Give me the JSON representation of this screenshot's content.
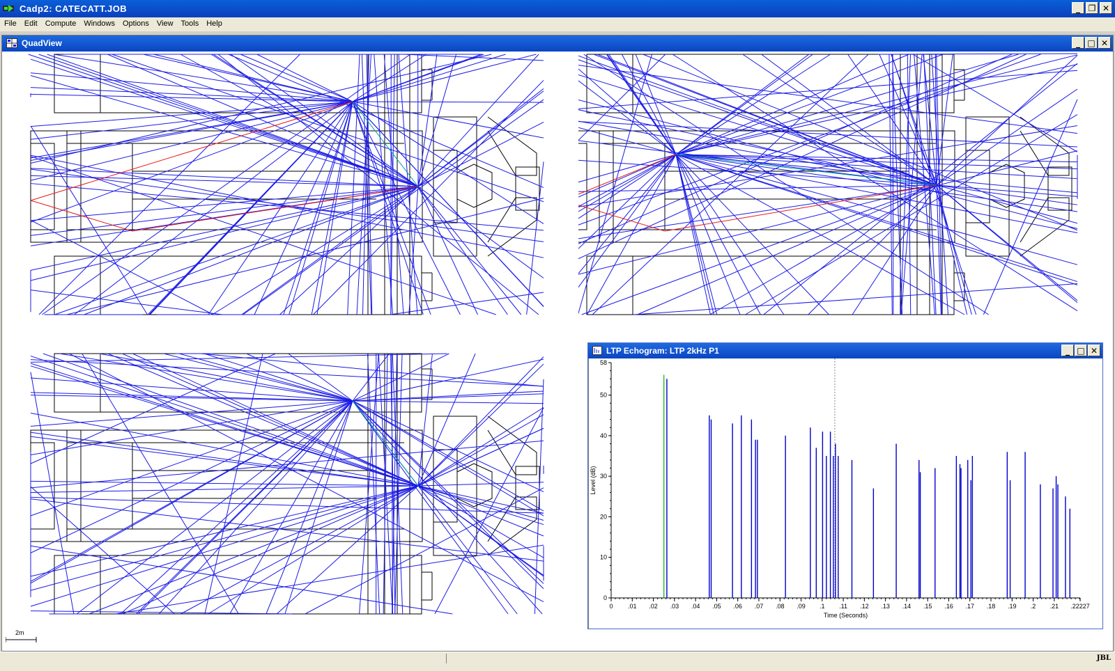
{
  "app": {
    "title": "Cadp2:  CATECATT.JOB",
    "window_buttons": {
      "minimize": "_",
      "restore": "❐",
      "close": "✕"
    }
  },
  "menu": [
    "File",
    "Edit",
    "Compute",
    "Windows",
    "Options",
    "View",
    "Tools",
    "Help"
  ],
  "quadview": {
    "title": "QuadView",
    "buttons": {
      "minimize": "_",
      "maximize": "□",
      "close": "✕"
    }
  },
  "echogram": {
    "title": "LTP Echogram: LTP 2kHz P1",
    "buttons": {
      "minimize": "_",
      "maximize": "□",
      "close": "✕"
    }
  },
  "scale_bar": {
    "label": "2m"
  },
  "status": {
    "brand": "JBL"
  },
  "colors": {
    "ray": "#1a1ae6",
    "direct_ray": "#e61a1a",
    "direct_echo": "#00b400",
    "title_blue": "#0a4fcf"
  },
  "chart_data": {
    "type": "bar",
    "title": "",
    "xlabel": "Time (Seconds)",
    "ylabel": "Level (dB)",
    "xlim": [
      0,
      0.22227
    ],
    "ylim": [
      0,
      58
    ],
    "x_ticks": [
      "0",
      ".01",
      ".02",
      ".03",
      ".04",
      ".05",
      ".06",
      ".07",
      ".08",
      ".09",
      ".1",
      ".11",
      ".12",
      ".13",
      ".14",
      ".15",
      ".16",
      ".17",
      ".18",
      ".19",
      ".2",
      ".21",
      ".22227"
    ],
    "y_ticks": [
      "0",
      "10",
      "20",
      "30",
      "40",
      "50",
      "58"
    ],
    "marker_time": 0.106,
    "direct": {
      "x": 0.025,
      "y": 55
    },
    "series": [
      {
        "values": [
          {
            "x": 0.0264,
            "y": 54
          },
          {
            "x": 0.0465,
            "y": 45
          },
          {
            "x": 0.0474,
            "y": 44
          },
          {
            "x": 0.0575,
            "y": 43
          },
          {
            "x": 0.0617,
            "y": 45
          },
          {
            "x": 0.0665,
            "y": 44
          },
          {
            "x": 0.0684,
            "y": 39
          },
          {
            "x": 0.0693,
            "y": 39
          },
          {
            "x": 0.0826,
            "y": 40
          },
          {
            "x": 0.0944,
            "y": 42
          },
          {
            "x": 0.0972,
            "y": 37
          },
          {
            "x": 0.1002,
            "y": 41
          },
          {
            "x": 0.102,
            "y": 35
          },
          {
            "x": 0.1039,
            "y": 41
          },
          {
            "x": 0.1053,
            "y": 35
          },
          {
            "x": 0.1063,
            "y": 38
          },
          {
            "x": 0.1076,
            "y": 35
          },
          {
            "x": 0.1141,
            "y": 34
          },
          {
            "x": 0.1243,
            "y": 27
          },
          {
            "x": 0.1351,
            "y": 38
          },
          {
            "x": 0.1459,
            "y": 34
          },
          {
            "x": 0.1465,
            "y": 31
          },
          {
            "x": 0.1535,
            "y": 32
          },
          {
            "x": 0.1636,
            "y": 35
          },
          {
            "x": 0.1653,
            "y": 33
          },
          {
            "x": 0.1658,
            "y": 32
          },
          {
            "x": 0.169,
            "y": 34
          },
          {
            "x": 0.1705,
            "y": 29
          },
          {
            "x": 0.1712,
            "y": 35
          },
          {
            "x": 0.1877,
            "y": 36
          },
          {
            "x": 0.1891,
            "y": 29
          },
          {
            "x": 0.1962,
            "y": 36
          },
          {
            "x": 0.2034,
            "y": 28
          },
          {
            "x": 0.2094,
            "y": 27
          },
          {
            "x": 0.2109,
            "y": 30
          },
          {
            "x": 0.2117,
            "y": 28
          },
          {
            "x": 0.2153,
            "y": 25
          },
          {
            "x": 0.2174,
            "y": 22
          }
        ]
      }
    ]
  }
}
